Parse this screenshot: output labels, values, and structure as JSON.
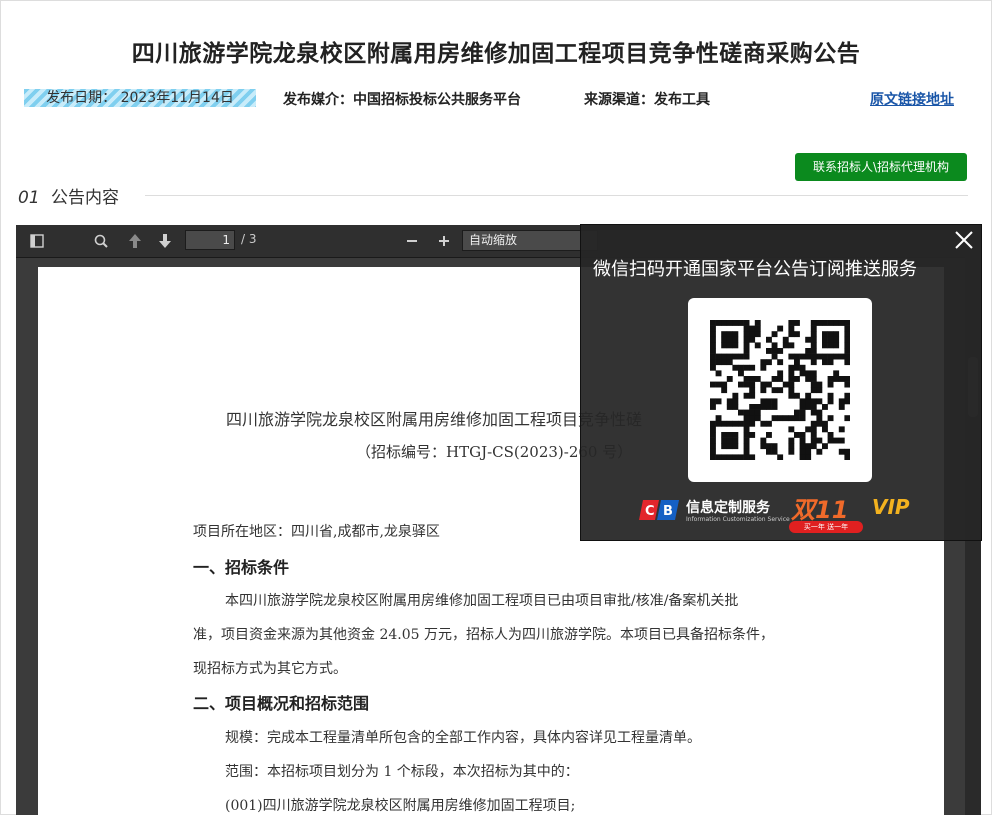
{
  "header": {
    "title": "四川旅游学院龙泉校区附属用房维修加固工程项目竞争性磋商采购公告",
    "publish_date": "发布日期：  2023年11月14日",
    "media": "发布媒介：中国招标投标公共服务平台",
    "channel": "来源渠道：发布工具",
    "source_link": "原文链接地址"
  },
  "contact_button": "联系招标人\\招标代理机构",
  "section": {
    "num": "01",
    "label": "公告内容"
  },
  "pdf_toolbar": {
    "page_current": "1",
    "page_total": "/ 3",
    "zoom": "自动缩放",
    "icons": [
      "sidebar-toggle-icon",
      "search-icon",
      "arrow-up-icon",
      "arrow-down-icon",
      "zoom-out-icon",
      "zoom-in-icon"
    ]
  },
  "document": {
    "title": "四川旅游学院龙泉校区附属用房维修加固工程项目竞争性磋",
    "code": "（招标编号：HTGJ-CS(2023)-260 号）",
    "region": "项目所在地区：四川省,成都市,龙泉驿区",
    "h1": "一、招标条件",
    "p1a": "本四川旅游学院龙泉校区附属用房维修加固工程项目已由项目审批/核准/备案机关批",
    "p1b": "准，项目资金来源为其他资金 24.05 万元，招标人为四川旅游学院。本项目已具备招标条件，",
    "p1c": "现招标方式为其它方式。",
    "h2": "二、项目概况和招标范围",
    "scale": "规模：完成本工程量清单所包含的全部工作内容，具体内容详见工程量清单。",
    "scope": "范围：本招标项目划分为 1 个标段，本次招标为其中的：",
    "item": "(001)四川旅游学院龙泉校区附属用房维修加固工程项目;"
  },
  "popup": {
    "title": "微信扫码开通国家平台公告订阅推送服务",
    "banner_text": "信息定制服务",
    "banner_sub": "Information Customization Service",
    "promo": "双11",
    "promo_sub": "买一年 送一年",
    "vip": "VIP"
  },
  "colors": {
    "accent_green": "#0b8a1e",
    "link_blue": "#1a56a8",
    "viewer_bg": "#3b3b3b",
    "popup_bg": "#262626"
  }
}
